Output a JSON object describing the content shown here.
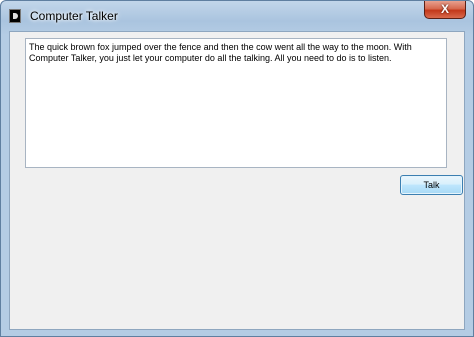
{
  "window": {
    "title": "Computer Talker",
    "close_glyph": "X"
  },
  "main": {
    "text_value": "The quick brown fox jumped over the fence and then the cow went all the way to the moon. With Computer Talker, you just let your computer do all the talking. All you need to do is to listen.",
    "talk_label": "Talk"
  },
  "icons": {
    "app": "app-icon",
    "close": "close-icon"
  },
  "colors": {
    "titlebar": "#b4cce4",
    "close_button": "#c3381a",
    "client_background": "#f0f0f0",
    "button_accent": "#3c7fb1"
  }
}
